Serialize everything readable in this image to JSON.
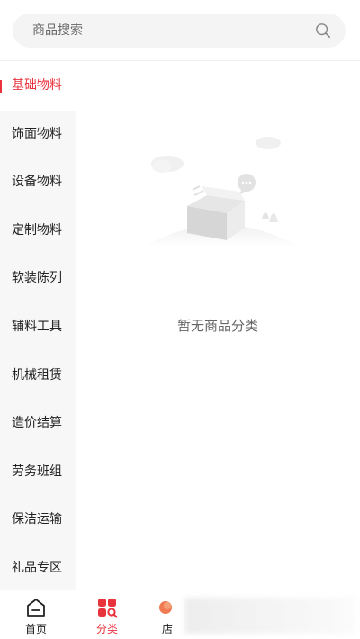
{
  "search": {
    "placeholder": "商品搜索"
  },
  "sidebar": {
    "items": [
      {
        "label": "基础物料",
        "active": true
      },
      {
        "label": "饰面物料"
      },
      {
        "label": "设备物料"
      },
      {
        "label": "定制物料"
      },
      {
        "label": "软装陈列"
      },
      {
        "label": "辅料工具"
      },
      {
        "label": "机械租赁"
      },
      {
        "label": "造价结算"
      },
      {
        "label": "劳务班组"
      },
      {
        "label": "保洁运输"
      },
      {
        "label": "礼品专区"
      }
    ]
  },
  "main": {
    "empty_text": "暂无商品分类"
  },
  "tabbar": {
    "items": [
      {
        "label": "首页",
        "icon": "home-icon"
      },
      {
        "label": "分类",
        "icon": "category-icon",
        "active": true
      },
      {
        "label": "店",
        "icon": "store-icon"
      }
    ]
  },
  "colors": {
    "accent": "#e8323c",
    "sidebar_bg": "#f7f7f7"
  }
}
